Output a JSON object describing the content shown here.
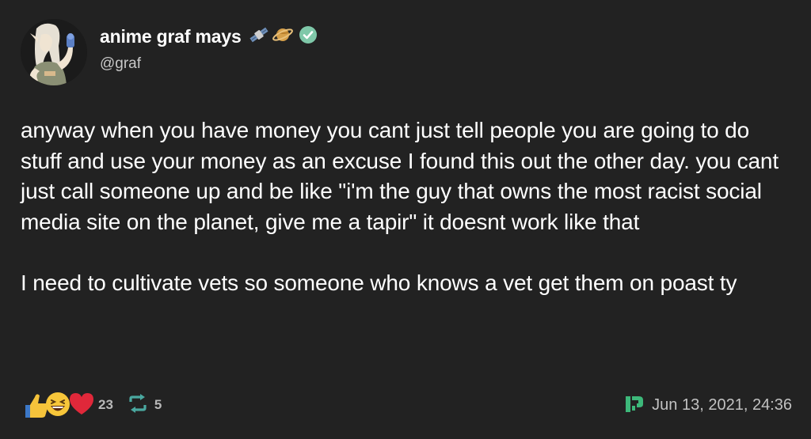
{
  "author": {
    "display_name": "anime graf mays",
    "handle": "@graf",
    "name_emojis": [
      "satellite-emoji",
      "planet-emoji"
    ],
    "verified": true
  },
  "post": {
    "paragraphs": [
      "anyway when you have money you cant just tell people you are going to do stuff and use your money as an excuse I found this out the other day. you cant just call someone up and be like \"i'm the guy that owns the most racist social media site on the planet, give me a tapir\" it doesnt work like that",
      "I need to cultivate vets so someone who knows a vet get them on poast ty"
    ]
  },
  "stats": {
    "reactions": [
      "thumbs-up-emoji",
      "laughing-emoji",
      "heart-emoji"
    ],
    "reaction_count": "23",
    "repost_count": "5"
  },
  "meta": {
    "timestamp": "Jun 13, 2021, 24:36"
  },
  "colors": {
    "background": "#222222",
    "text": "#ffffff",
    "muted": "#c2c2c2",
    "verified": "#7fc8a9",
    "repost": "#4aa8a0",
    "source_logo": "#3db87a"
  }
}
